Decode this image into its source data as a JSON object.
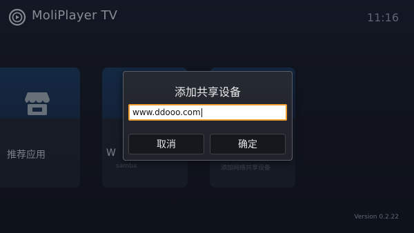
{
  "header": {
    "app_title": "MoliPlayer TV",
    "clock": "11:16",
    "logo_icon": "play-circle-icon"
  },
  "tiles": [
    {
      "label": "推荐应用",
      "sub": "",
      "icon": "store-icon"
    },
    {
      "label": "W",
      "sub": "samba",
      "icon": ""
    },
    {
      "label": "",
      "sub": "添加网络共享设备",
      "icon": ""
    }
  ],
  "dialog": {
    "title": "添加共享设备",
    "input_value": "www.ddooo.com",
    "cancel_label": "取消",
    "ok_label": "确定"
  },
  "footer": {
    "version": "Version 0.2.22"
  },
  "colors": {
    "accent_focus": "#f0a032",
    "tile_top": "#1b3b60",
    "background": "#151b27"
  }
}
